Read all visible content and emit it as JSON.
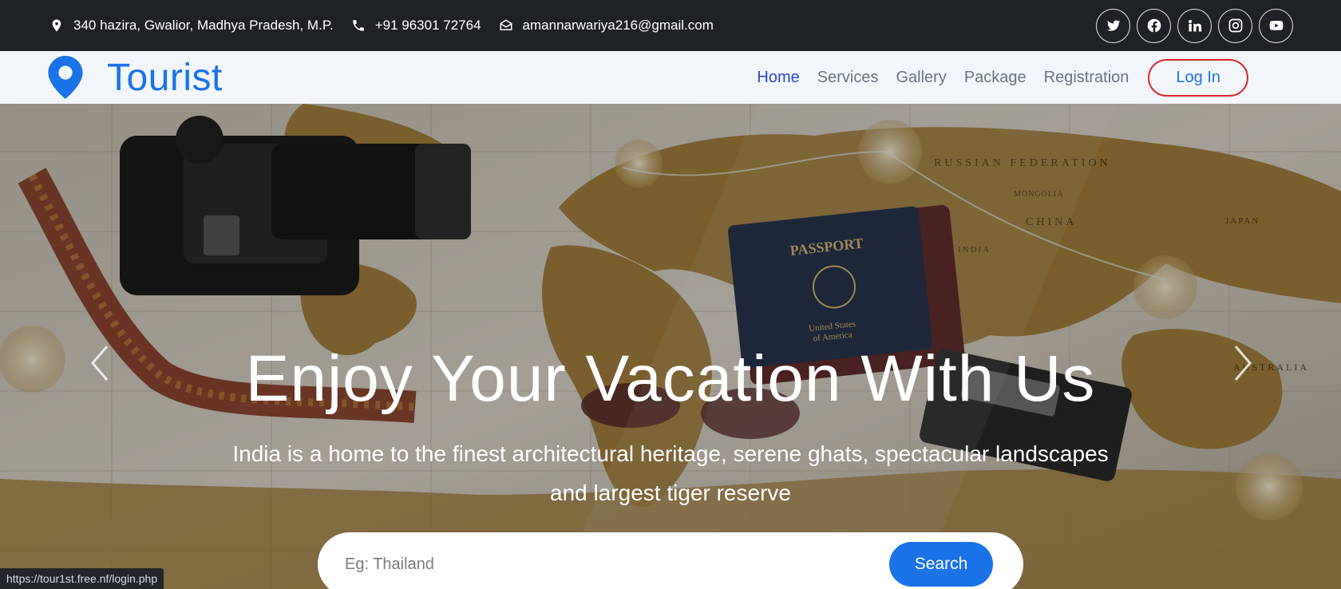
{
  "topbar": {
    "address": "340 hazira, Gwalior, Madhya Pradesh, M.P.",
    "phone": "+91 96301 72764",
    "email": "amannarwariya216@gmail.com",
    "socials": [
      "twitter-icon",
      "facebook-icon",
      "linkedin-icon",
      "instagram-icon",
      "youtube-icon"
    ]
  },
  "navbar": {
    "brand": "Tourist",
    "links": [
      "Home",
      "Services",
      "Gallery",
      "Package",
      "Registration"
    ],
    "active": "Home",
    "login": "Log In"
  },
  "hero": {
    "title": "Enjoy Your Vacation With Us",
    "subtitle": "India is a home to the finest architectural heritage, serene ghats, spectacular landscapes and largest tiger reserve",
    "search_placeholder": "Eg: Thailand",
    "search_button": "Search",
    "map_labels": [
      "RUSSIAN FEDERATION",
      "CHINA",
      "MONGOLIA",
      "INDIA",
      "JAPAN",
      "AUSTRALIA",
      "PASSPORT",
      "United States of America"
    ]
  },
  "statusbar": {
    "url": "https://tour1st.free.nf/login.php"
  },
  "colors": {
    "brand": "#1b73e8",
    "active_nav": "#2a45d6",
    "topbar": "#1e2226",
    "login_ring": "#d92a2a"
  }
}
